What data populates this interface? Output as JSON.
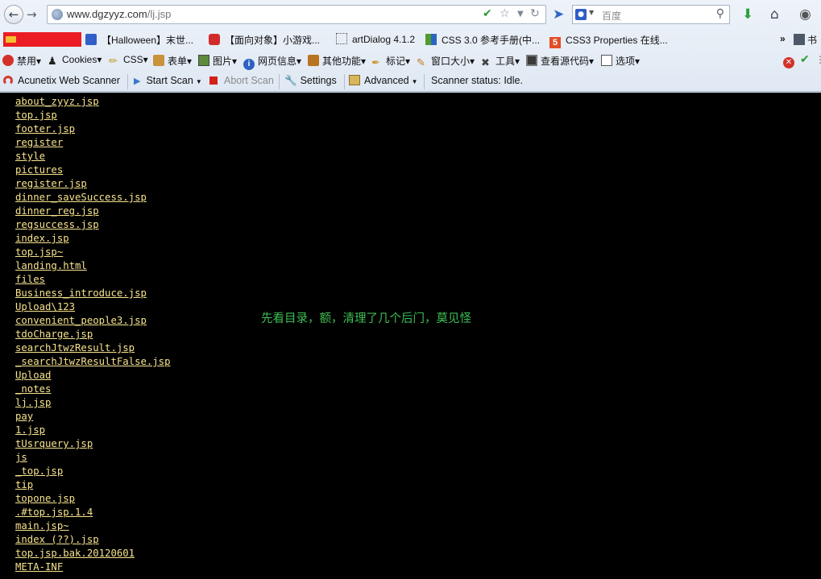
{
  "browser": {
    "url_domain": "www.dgzyyz.com",
    "url_path": "/lj.jsp",
    "search_placeholder": "百度"
  },
  "bookmarks": [
    {
      "label": "【Halloween】末世...",
      "icon": "paw-icon"
    },
    {
      "label": "【面向对象】小游戏...",
      "icon": "c-logo-icon"
    },
    {
      "label": "artDialog 4.1.2",
      "icon": "dotted-box-icon"
    },
    {
      "label": "CSS 3.0 参考手册(中...",
      "icon": "grid-icon"
    },
    {
      "label": "CSS3 Properties 在线...",
      "icon": "html5-icon"
    },
    {
      "label": "书",
      "icon": "bookmark-icon"
    }
  ],
  "webdev_toolbar": [
    {
      "label": "禁用▾",
      "icon": "disable-icon"
    },
    {
      "label": "Cookies▾",
      "icon": "person-icon"
    },
    {
      "label": "CSS▾",
      "icon": "pencil-icon"
    },
    {
      "label": "表单▾",
      "icon": "clipboard-icon"
    },
    {
      "label": "图片▾",
      "icon": "image-icon"
    },
    {
      "label": "网页信息▾",
      "icon": "info-icon"
    },
    {
      "label": "其他功能▾",
      "icon": "book-icon"
    },
    {
      "label": "标记▾",
      "icon": "pen-icon"
    },
    {
      "label": "窗口大小▾",
      "icon": "ruler-icon"
    },
    {
      "label": "工具▾",
      "icon": "tools-icon"
    },
    {
      "label": "查看源代码▾",
      "icon": "monitor-icon"
    },
    {
      "label": "选项▾",
      "icon": "options-icon"
    }
  ],
  "acunetix_toolbar": {
    "title": "Acunetix Web Scanner",
    "start_scan": "Start Scan",
    "abort_scan": "Abort Scan",
    "settings": "Settings",
    "advanced": "Advanced",
    "status": "Scanner status: Idle."
  },
  "directory_listing": [
    "about_zyyz.jsp",
    "top.jsp",
    "footer.jsp",
    "register",
    "style",
    "pictures",
    "register.jsp",
    "dinner_saveSuccess.jsp",
    "dinner_reg.jsp",
    "regsuccess.jsp",
    "index.jsp",
    "top.jsp~",
    "landing.html",
    "files",
    "Business_introduce.jsp",
    "Upload\\123",
    "convenient_people3.jsp",
    "tdoCharge.jsp",
    "searchJtwzResult.jsp",
    "_searchJtwzResultFalse.jsp",
    "Upload",
    "_notes",
    "lj.jsp",
    "pay",
    "1.jsp",
    "tUsrquery.jsp",
    "js",
    "_top.jsp",
    "tip",
    "topone.jsp",
    ".#top.jsp.1.4",
    "main.jsp~",
    "index (??).jsp",
    "top.jsp.bak.20120601",
    "META-INF"
  ],
  "annotation": "先看目录，额，清理了几个后门，莫见怪",
  "colors": {
    "page_background": "#000000",
    "link_color": "#f7e38d",
    "annotation_color": "#3fbe54"
  }
}
